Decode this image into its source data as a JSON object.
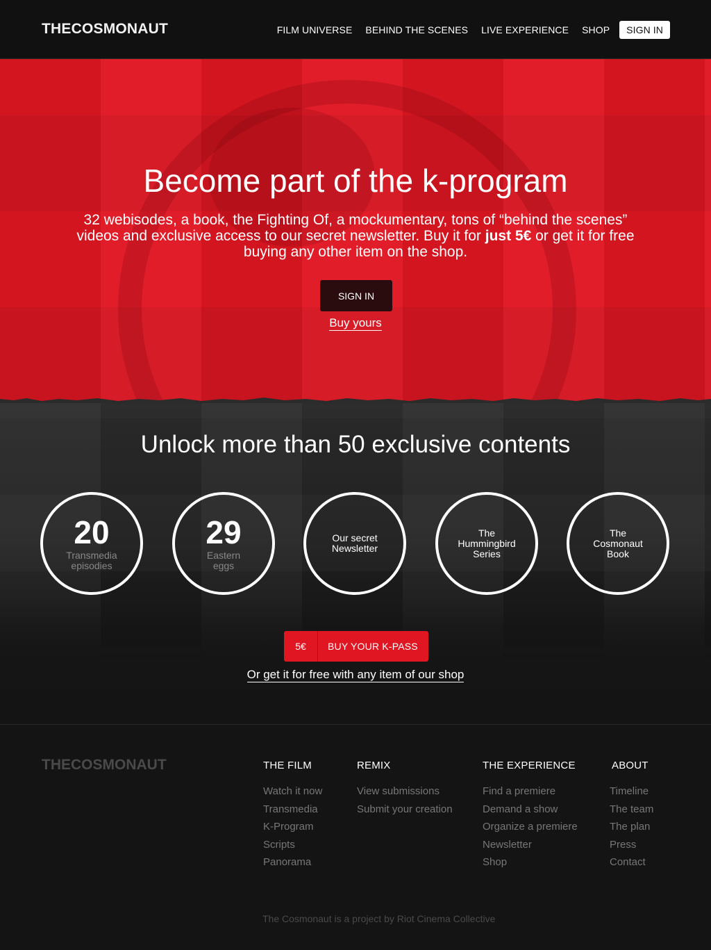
{
  "header": {
    "logo": "THECOSMONAUT",
    "nav": [
      "FILM UNIVERSE",
      "BEHIND THE SCENES",
      "LIVE EXPERIENCE",
      "SHOP"
    ],
    "signin": "SIGN IN"
  },
  "hero": {
    "title": "Become part of the k-program",
    "desc_start": "32 webisodes, a book, the Fighting Of, a mockumentary, tons of “behind the scenes” videos and exclusive access to our secret newsletter. Buy it for ",
    "desc_price": "just 5€",
    "desc_end": " or get it for free buying any other item on the shop.",
    "signin": "SIGN IN",
    "buy_link": "Buy yours"
  },
  "unlock": {
    "title": "Unlock more than 50 exclusive contents",
    "circles": [
      {
        "num": "20",
        "sub": "Transmedia episodies"
      },
      {
        "num": "29",
        "sub": "Eastern eggs"
      },
      {
        "label": "Our secret Newsletter"
      },
      {
        "label": "The Hummingbird Series"
      },
      {
        "label": "The Cosmonaut Book"
      }
    ],
    "kpass_price": "5€",
    "kpass_label": "BUY YOUR K-PASS",
    "free_link": "Or get it for free with any item of our shop"
  },
  "footer": {
    "logo": "THECOSMONAUT",
    "columns": [
      {
        "title": "THE FILM",
        "links": [
          "Watch it now",
          "Transmedia",
          "K-Program",
          "Scripts",
          "Panorama"
        ]
      },
      {
        "title": "REMIX",
        "links": [
          "View submissions",
          "Submit your creation"
        ]
      },
      {
        "title": "THE EXPERIENCE",
        "links": [
          "Find a premiere",
          "Demand a show",
          "Organize a premiere",
          "Newsletter",
          "Shop"
        ]
      },
      {
        "title": "ABOUT",
        "links": [
          "Timeline",
          "The team",
          "The plan",
          "Press",
          "Contact"
        ]
      }
    ],
    "credit": "The Cosmonaut is a project by Riot Cinema Collective"
  },
  "colors": {
    "accent": "#e01622",
    "background": "#141414",
    "muted_text": "#777777"
  }
}
